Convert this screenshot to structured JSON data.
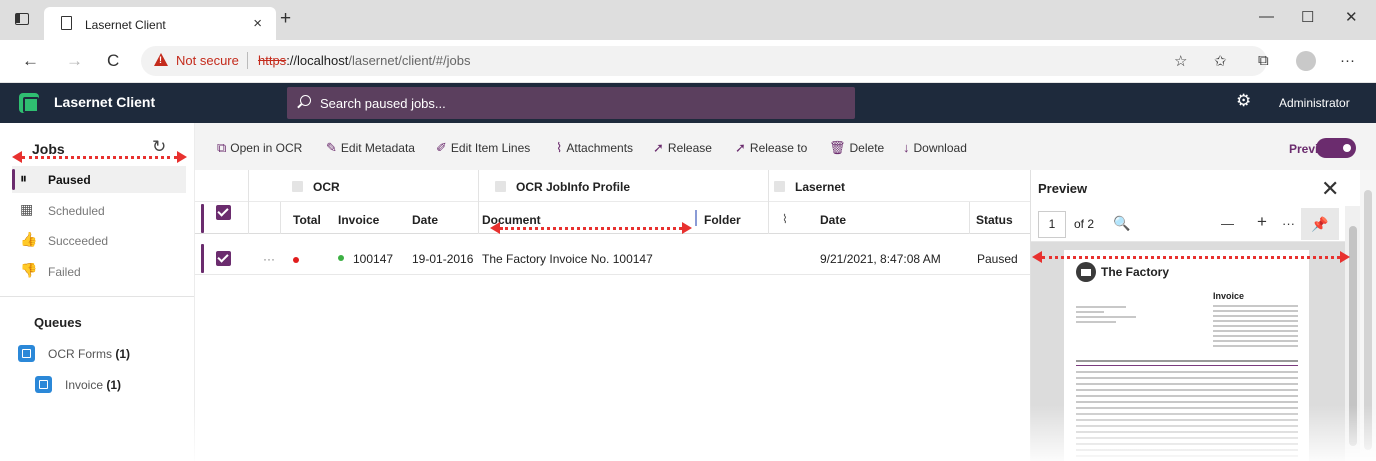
{
  "browser": {
    "tab_title": "Lasernet Client",
    "tab_close": "×",
    "new_tab": "+",
    "minimize": "—",
    "maximize": "☐",
    "close": "✕",
    "back": "←",
    "forward": "→",
    "reload": "C",
    "not_secure": "Not secure",
    "url_proto": "https",
    "url_host": "://localhost",
    "url_path": "/lasernet/client/#/jobs",
    "more": "···",
    "favorite_icon": "☆",
    "favorites_icon": "✩",
    "collections_icon": "⧉",
    "accent": "#c42b1c"
  },
  "app": {
    "title": "Lasernet Client",
    "search_placeholder": "Search paused jobs...",
    "settings_icon": "⚙",
    "user": "Administrator",
    "brand_color": "#6b2c6e",
    "header_color": "#1e2a3c"
  },
  "sidebar": {
    "jobs_title": "Jobs",
    "refresh_icon": "↻",
    "items": [
      {
        "label": "Paused",
        "icon": "⏸",
        "active": true
      },
      {
        "label": "Scheduled",
        "icon": "▦"
      },
      {
        "label": "Succeeded",
        "icon": "👍"
      },
      {
        "label": "Failed",
        "icon": "👎"
      }
    ],
    "queues_title": "Queues",
    "queues": [
      {
        "label": "OCR Forms",
        "count": "(1)"
      },
      {
        "label": "Invoice",
        "count": "(1)"
      }
    ]
  },
  "toolbar": {
    "open_ocr": "Open in OCR",
    "edit_metadata": "Edit Metadata",
    "edit_item_lines": "Edit Item Lines",
    "attachments": "Attachments",
    "release": "Release",
    "release_to": "Release to",
    "delete": "Delete",
    "download": "Download",
    "preview": "Preview",
    "preview_on": true
  },
  "table": {
    "groups": [
      "OCR",
      "OCR JobInfo Profile",
      "Lasernet"
    ],
    "columns": [
      "Total",
      "Invoice",
      "Date",
      "Document",
      "Folder",
      "Date",
      "Status"
    ],
    "rows": [
      {
        "more": "···",
        "total_status": "red",
        "invoice_status": "green",
        "invoice": "100147",
        "date": "19-01-2016",
        "document": "The Factory Invoice No. 100147",
        "folder": "",
        "ln_date": "9/21/2021, 8:47:08 AM",
        "status": "Paused",
        "selected": true
      }
    ]
  },
  "preview": {
    "title": "Preview",
    "close": "✕",
    "page": "1",
    "of_pages": "of 2",
    "search_icon": "🔍",
    "zoom_out": "—",
    "zoom_in": "+",
    "more": "···",
    "pin_icon": "📌",
    "doc_company": "The Factory",
    "doc_heading": "Invoice"
  }
}
